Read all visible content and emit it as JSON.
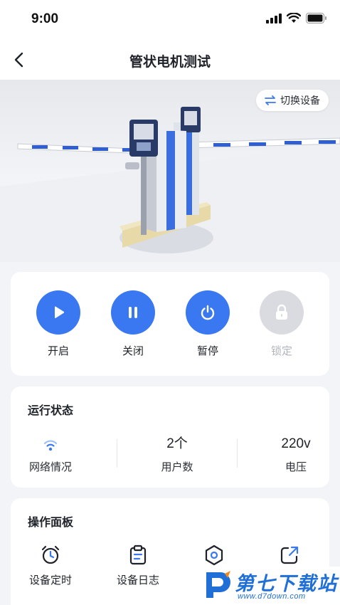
{
  "status_bar": {
    "time": "9:00"
  },
  "header": {
    "title": "管状电机测试"
  },
  "hero": {
    "switch_label": "切换设备"
  },
  "controls": [
    {
      "label": "开启",
      "icon": "play-icon",
      "enabled": true
    },
    {
      "label": "关闭",
      "icon": "pause-icon",
      "enabled": true
    },
    {
      "label": "暂停",
      "icon": "power-icon",
      "enabled": true
    },
    {
      "label": "锁定",
      "icon": "lock-icon",
      "enabled": false
    }
  ],
  "run_status": {
    "title": "运行状态",
    "network_label": "网络情况",
    "users_value": "2个",
    "users_label": "用户数",
    "voltage_value": "220v",
    "voltage_label": "电压"
  },
  "panel": {
    "title": "操作面板",
    "items": [
      {
        "label": "设备定时",
        "icon": "alarm-clock-icon"
      },
      {
        "label": "设备日志",
        "icon": "clipboard-icon"
      },
      {
        "label": "设",
        "icon": "settings-hexagon-icon"
      },
      {
        "label": "分",
        "icon": "share-icon"
      }
    ]
  },
  "watermark": {
    "title": "第七下载站",
    "url": "www.d7down.com"
  },
  "colors": {
    "accent": "#3a78f2",
    "disabled": "#d9dbe0",
    "background": "#f2f4f8"
  }
}
